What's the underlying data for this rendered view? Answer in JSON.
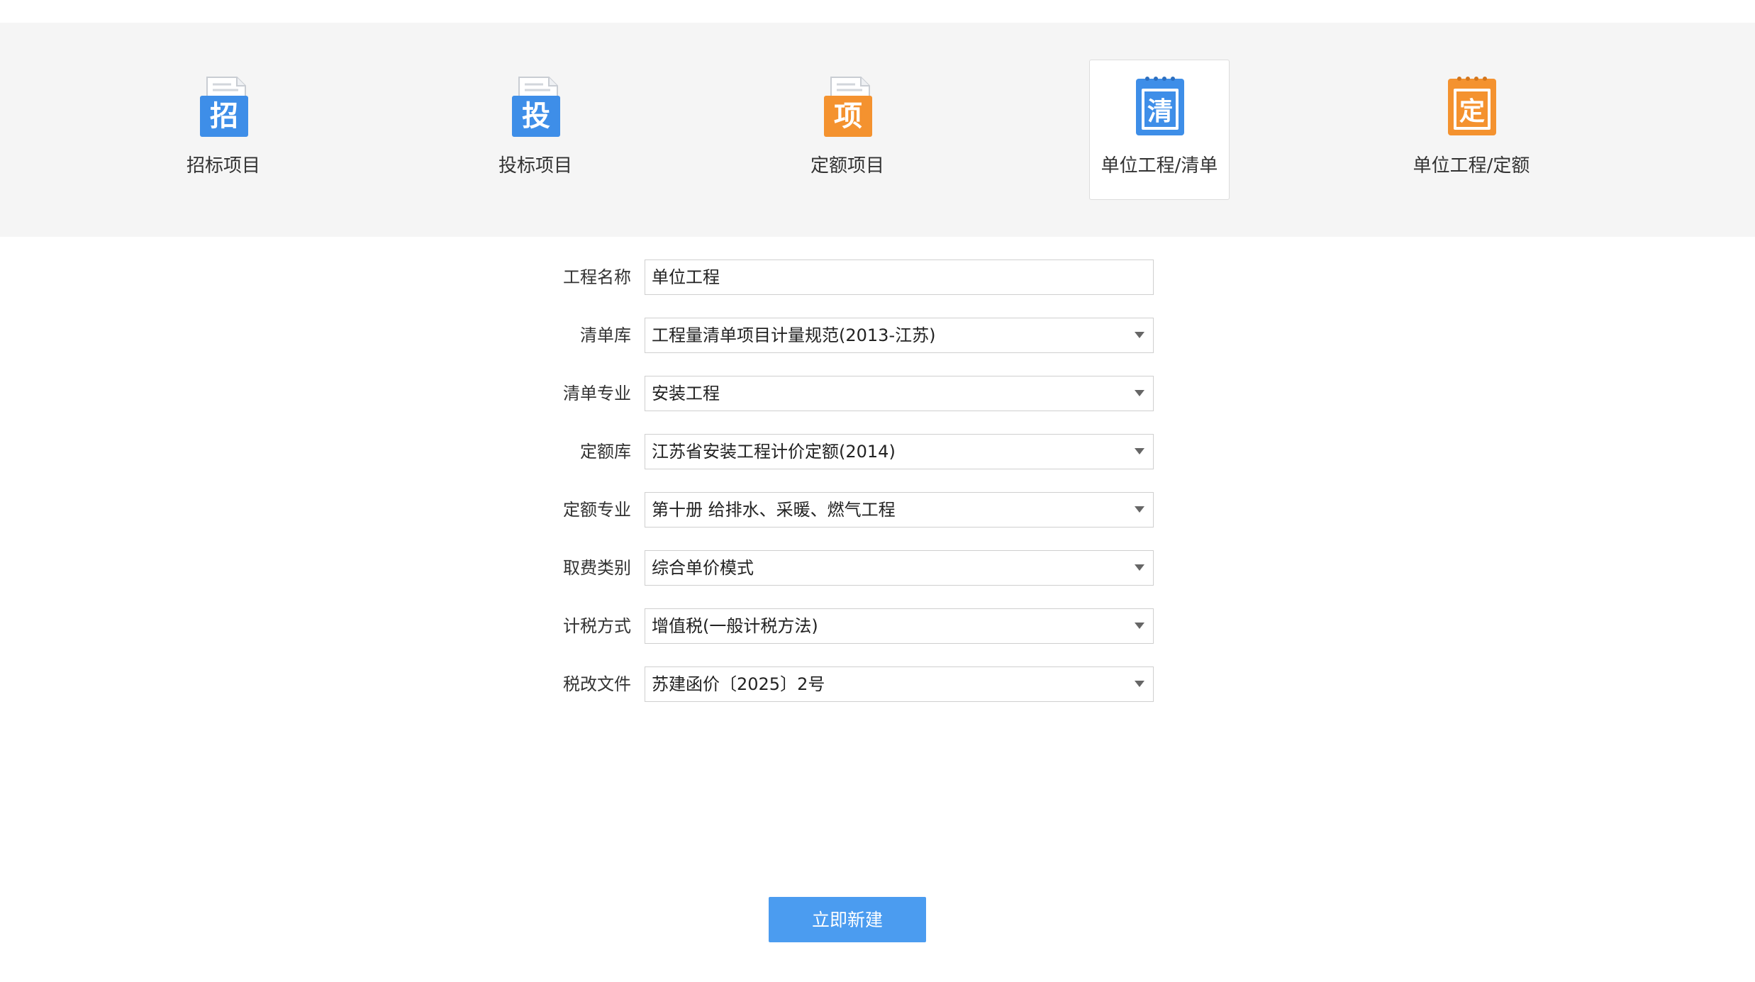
{
  "tabs": [
    {
      "label": "招标项目",
      "icon_char": "招",
      "icon": "zhao-doc-icon",
      "color": "#3e8ee8"
    },
    {
      "label": "投标项目",
      "icon_char": "投",
      "icon": "tou-doc-icon",
      "color": "#3e8ee8"
    },
    {
      "label": "定额项目",
      "icon_char": "项",
      "icon": "xiang-doc-icon",
      "color": "#f4922f"
    },
    {
      "label": "单位工程/清单",
      "icon_char": "清",
      "icon": "qing-notepad-icon",
      "color": "#3e8ee8",
      "selected": true
    },
    {
      "label": "单位工程/定额",
      "icon_char": "定",
      "icon": "ding-notepad-icon",
      "color": "#f4922f"
    }
  ],
  "form": {
    "project_name": {
      "label": "工程名称",
      "value": "单位工程"
    },
    "bill_library": {
      "label": "清单库",
      "value": "工程量清单项目计量规范(2013-江苏)"
    },
    "bill_specialty": {
      "label": "清单专业",
      "value": "安装工程"
    },
    "quota_library": {
      "label": "定额库",
      "value": "江苏省安装工程计价定额(2014)"
    },
    "quota_specialty": {
      "label": "定额专业",
      "value": "第十册 给排水、采暖、燃气工程"
    },
    "fee_category": {
      "label": "取费类别",
      "value": "综合单价模式"
    },
    "tax_method": {
      "label": "计税方式",
      "value": "增值税(一般计税方法)"
    },
    "tax_document": {
      "label": "税改文件",
      "value": "苏建函价〔2025〕2号"
    }
  },
  "create_button": {
    "label": "立即新建",
    "color": "#4b9cf0"
  }
}
